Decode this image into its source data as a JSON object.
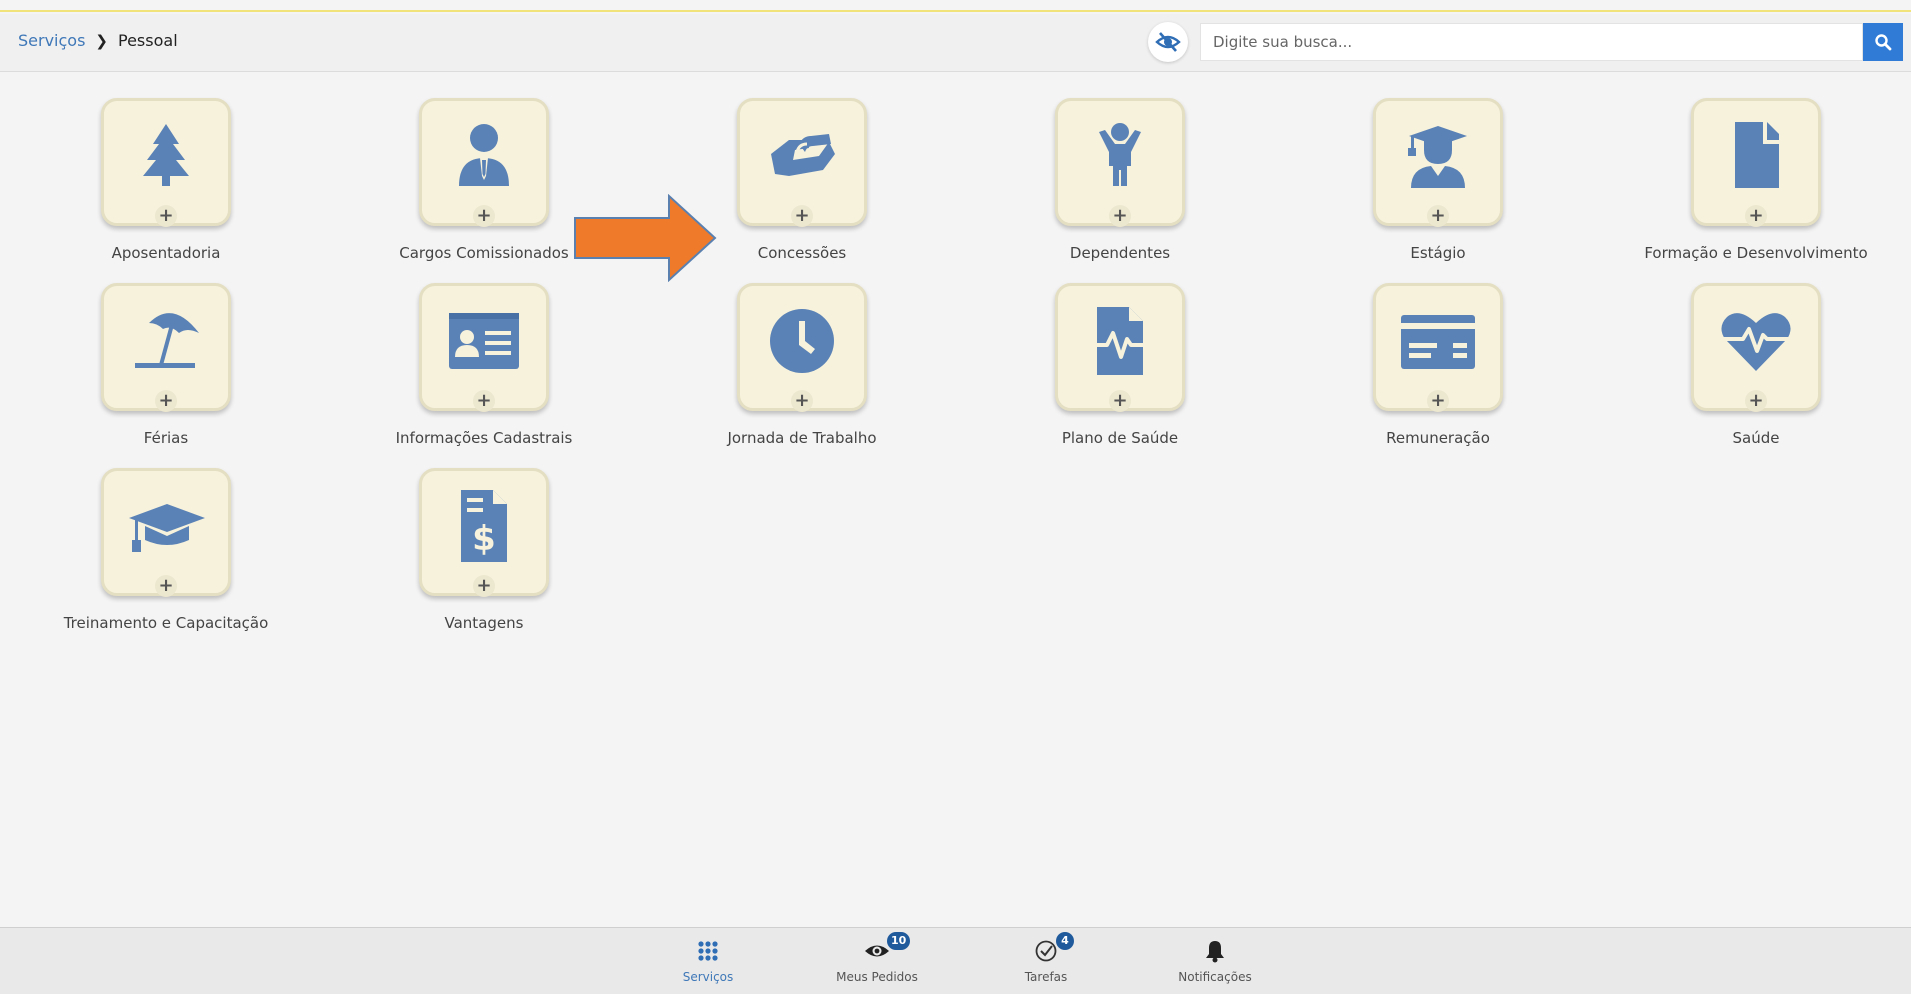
{
  "header": {
    "breadcrumb": {
      "root": "Serviços",
      "current": "Pessoal"
    },
    "search": {
      "placeholder": "Digite sua busca..."
    }
  },
  "colors": {
    "icon": "#5b82b6",
    "tile_bg": "#f6f2dc",
    "arrow": "#ef7a2a",
    "primary": "#2f7bd6"
  },
  "tiles": [
    {
      "label": "Aposentadoria",
      "icon": "tree-icon"
    },
    {
      "label": "Cargos Comissionados",
      "icon": "businessman-icon"
    },
    {
      "label": "Concessões",
      "icon": "handshake-icon"
    },
    {
      "label": "Dependentes",
      "icon": "child-icon"
    },
    {
      "label": "Estágio",
      "icon": "graduate-icon"
    },
    {
      "label": "Formação e Desenvolvimento",
      "icon": "document-icon"
    },
    {
      "label": "Férias",
      "icon": "beach-umbrella-icon"
    },
    {
      "label": "Informações Cadastrais",
      "icon": "id-card-icon"
    },
    {
      "label": "Jornada de Trabalho",
      "icon": "clock-icon"
    },
    {
      "label": "Plano de Saúde",
      "icon": "medical-file-icon"
    },
    {
      "label": "Remuneração",
      "icon": "credit-card-icon"
    },
    {
      "label": "Saúde",
      "icon": "heartbeat-icon"
    },
    {
      "label": "Treinamento e Capacitação",
      "icon": "mortarboard-icon"
    },
    {
      "label": "Vantagens",
      "icon": "invoice-dollar-icon"
    }
  ],
  "tile_plus": "+",
  "bottom_nav": [
    {
      "label": "Serviços",
      "icon": "grid-icon"
    },
    {
      "label": "Meus Pedidos",
      "icon": "eye-icon",
      "badge": "10"
    },
    {
      "label": "Tarefas",
      "icon": "check-circle-icon",
      "badge": "4"
    },
    {
      "label": "Notificações",
      "icon": "bell-icon"
    }
  ]
}
